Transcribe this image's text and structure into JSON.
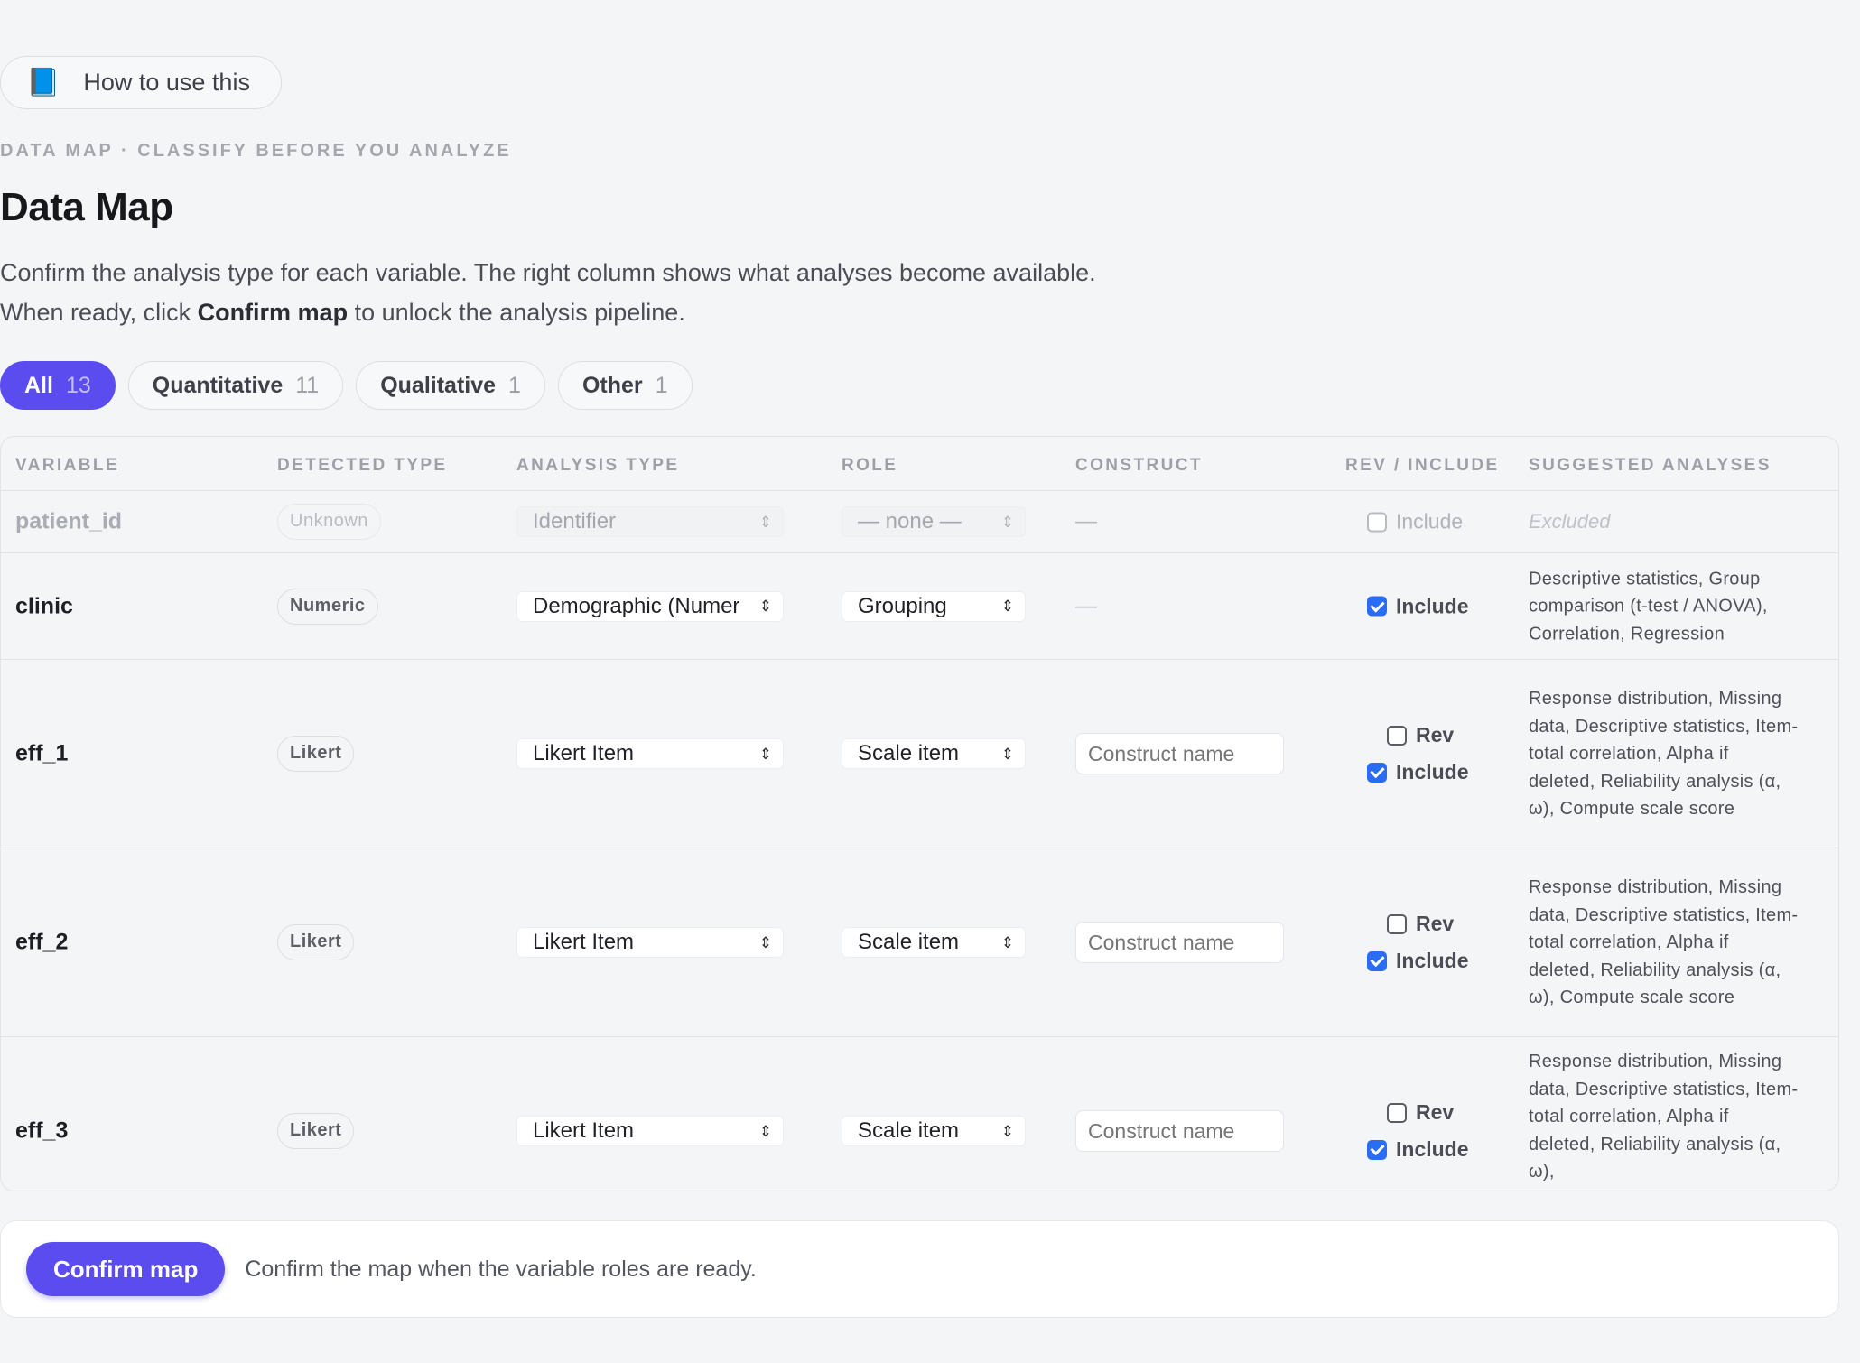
{
  "help": {
    "label": "How to use this",
    "icon": "blue-book"
  },
  "eyebrow": "DATA MAP · CLASSIFY BEFORE YOU ANALYZE",
  "title": "Data Map",
  "description": {
    "line1": "Confirm the analysis type for each variable. The right column shows what analyses become available.",
    "line2_before": "When ready, click ",
    "line2_bold": "Confirm map",
    "line2_after": " to unlock the analysis pipeline."
  },
  "filters": [
    {
      "label": "All",
      "count": "13",
      "active": true
    },
    {
      "label": "Quantitative",
      "count": "11",
      "active": false
    },
    {
      "label": "Qualitative",
      "count": "1",
      "active": false
    },
    {
      "label": "Other",
      "count": "1",
      "active": false
    }
  ],
  "columns": {
    "variable": "VARIABLE",
    "detected_type": "DETECTED TYPE",
    "analysis_type": "ANALYSIS TYPE",
    "role": "ROLE",
    "construct": "CONSTRUCT",
    "rev_include": "REV / INCLUDE",
    "suggested": "SUGGESTED ANALYSES"
  },
  "rows": [
    {
      "variable": "patient_id",
      "detected": "Unknown",
      "analysis": "Identifier",
      "role": "— none —",
      "construct": "—",
      "rev": null,
      "include": false,
      "include_label": "Include",
      "suggested": "Excluded",
      "excluded": true
    },
    {
      "variable": "clinic",
      "detected": "Numeric",
      "analysis": "Demographic (Numer",
      "role": "Grouping",
      "construct": "—",
      "rev": null,
      "include": true,
      "include_label": "Include",
      "suggested": "Descriptive statistics, Group comparison (t-test / ANOVA), Correlation, Regression",
      "excluded": false
    },
    {
      "variable": "eff_1",
      "detected": "Likert",
      "analysis": "Likert Item",
      "role": "Scale item",
      "construct_placeholder": "Construct name",
      "rev": false,
      "rev_label": "Rev",
      "include": true,
      "include_label": "Include",
      "suggested": "Response distribution, Missing data, Descriptive statistics, Item-total correlation, Alpha if deleted, Reliability analysis (α, ω), Compute scale score",
      "excluded": false
    },
    {
      "variable": "eff_2",
      "detected": "Likert",
      "analysis": "Likert Item",
      "role": "Scale item",
      "construct_placeholder": "Construct name",
      "rev": false,
      "rev_label": "Rev",
      "include": true,
      "include_label": "Include",
      "suggested": "Response distribution, Missing data, Descriptive statistics, Item-total correlation, Alpha if deleted, Reliability analysis (α, ω), Compute scale score",
      "excluded": false
    },
    {
      "variable": "eff_3",
      "detected": "Likert",
      "analysis": "Likert Item",
      "role": "Scale item",
      "construct_placeholder": "Construct name",
      "rev": false,
      "rev_label": "Rev",
      "include": true,
      "include_label": "Include",
      "suggested": "Response distribution, Missing data, Descriptive statistics, Item-total correlation, Alpha if deleted, Reliability analysis (α, ω),",
      "excluded": false
    }
  ],
  "footer": {
    "button": "Confirm map",
    "text": "Confirm the map when the variable roles are ready."
  },
  "colors": {
    "accent": "#5b4cf0",
    "checkbox": "#2a6df5",
    "background": "#f4f5f7"
  }
}
